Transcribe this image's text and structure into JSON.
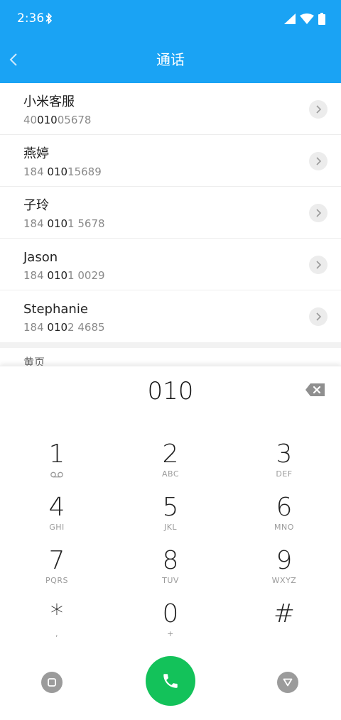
{
  "status_bar": {
    "time": "2:36",
    "bluetooth_icon": "bluetooth-icon",
    "signal_icon": "cellular-signal-icon",
    "wifi_icon": "wifi-icon",
    "battery_icon": "battery-icon"
  },
  "header": {
    "title": "通话",
    "back_icon": "chevron-left-icon",
    "background_color": "#1aa3f4"
  },
  "results": [
    {
      "name": "小米客服",
      "number_parts": [
        "40",
        "010",
        "05678"
      ]
    },
    {
      "name": "燕婷",
      "number_parts": [
        "184 ",
        "010",
        "15689"
      ]
    },
    {
      "name": "子玲",
      "number_parts": [
        "184 ",
        "010",
        "1 5678"
      ]
    },
    {
      "name": "Jason",
      "number_parts": [
        "184 ",
        "010",
        "1 0029"
      ]
    },
    {
      "name": "Stephanie",
      "number_parts": [
        "184 ",
        "010",
        "2 4685"
      ]
    }
  ],
  "section_label": "黄页",
  "dialpad": {
    "typed_number": "010",
    "backspace_icon": "backspace-icon",
    "keys": [
      {
        "digit": "1",
        "letters": "",
        "icon": "voicemail-icon"
      },
      {
        "digit": "2",
        "letters": "ABC"
      },
      {
        "digit": "3",
        "letters": "DEF"
      },
      {
        "digit": "4",
        "letters": "GHI"
      },
      {
        "digit": "5",
        "letters": "JKL"
      },
      {
        "digit": "6",
        "letters": "MNO"
      },
      {
        "digit": "7",
        "letters": "PQRS"
      },
      {
        "digit": "8",
        "letters": "TUV"
      },
      {
        "digit": "9",
        "letters": "WXYZ"
      },
      {
        "digit": "*",
        "letters": ","
      },
      {
        "digit": "0",
        "letters": "+"
      },
      {
        "digit": "#",
        "letters": ""
      }
    ],
    "call_color": "#13c25a",
    "left_nav_icon": "square-icon",
    "right_nav_icon": "triangle-down-icon",
    "call_icon": "phone-icon"
  }
}
